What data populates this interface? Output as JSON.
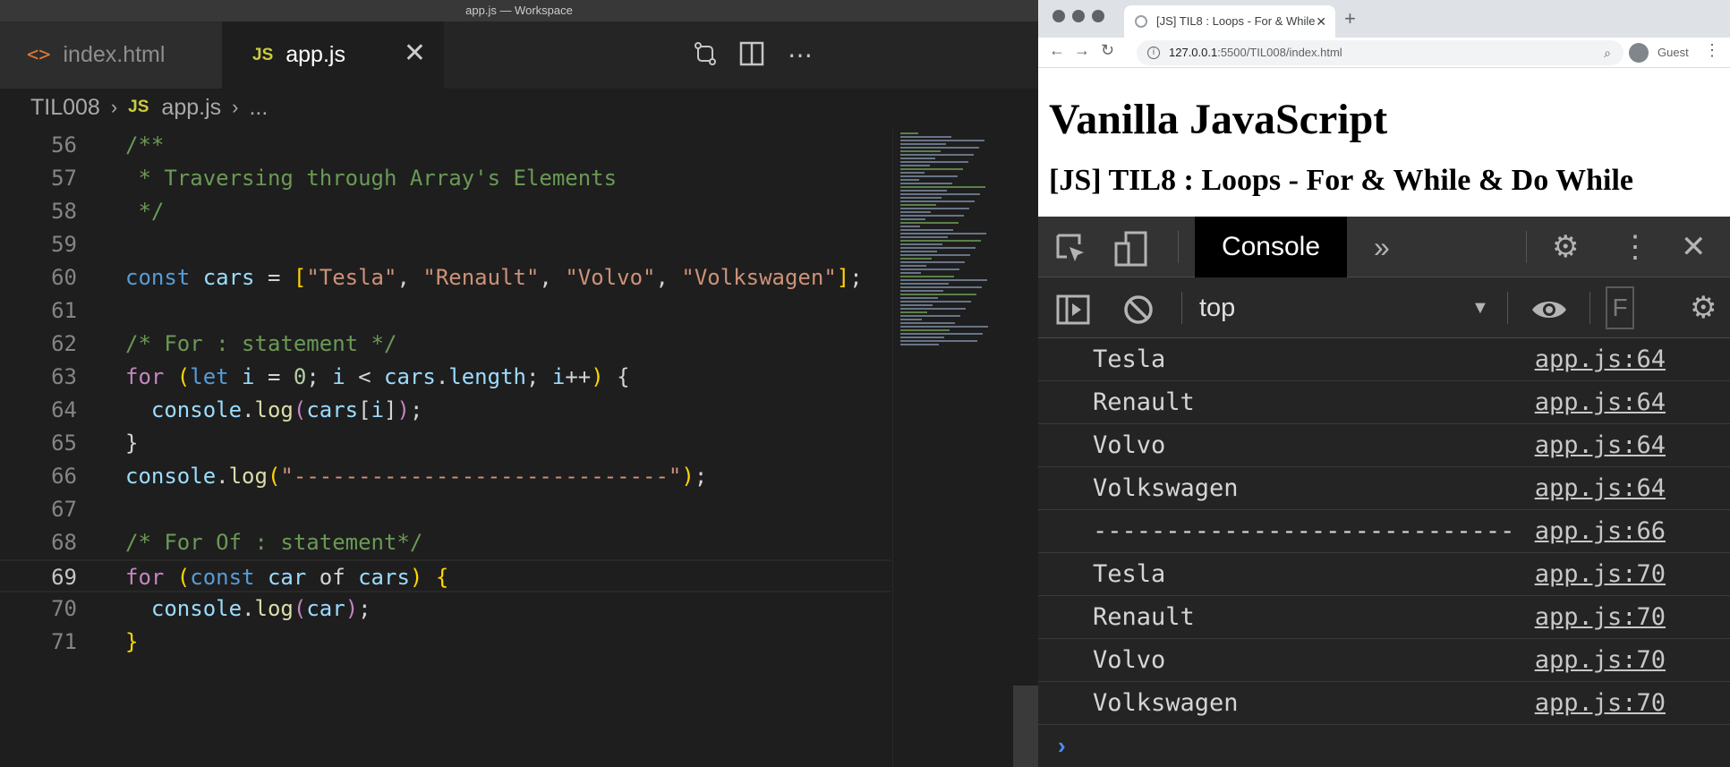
{
  "editor": {
    "window_title": "app.js — Workspace",
    "tabs": [
      {
        "label": "index.html",
        "icon": "html-icon"
      },
      {
        "label": "app.js",
        "icon": "js-icon",
        "active": true
      }
    ],
    "tab_close": "✕",
    "breadcrumb": [
      "TIL008",
      "app.js",
      "..."
    ],
    "breadcrumb_js_icon": "JS",
    "html_icon_glyph": "<>",
    "lines": [
      {
        "num": "56",
        "parts": [
          [
            "c",
            "/**"
          ]
        ]
      },
      {
        "num": "57",
        "parts": [
          [
            "c",
            " * Traversing through Array's Elements"
          ]
        ]
      },
      {
        "num": "58",
        "parts": [
          [
            "c",
            " */"
          ]
        ]
      },
      {
        "num": "59",
        "parts": []
      },
      {
        "num": "60",
        "parts": [
          [
            "k",
            "const "
          ],
          [
            "v",
            "cars"
          ],
          [
            "w",
            " = "
          ],
          [
            "y",
            "["
          ],
          [
            "s",
            "\"Tesla\""
          ],
          [
            "w",
            ", "
          ],
          [
            "s",
            "\"Renault\""
          ],
          [
            "w",
            ", "
          ],
          [
            "s",
            "\"Volvo\""
          ],
          [
            "w",
            ", "
          ],
          [
            "s",
            "\"Volkswagen\""
          ],
          [
            "y",
            "]"
          ],
          [
            "w",
            ";"
          ]
        ]
      },
      {
        "num": "61",
        "parts": []
      },
      {
        "num": "62",
        "parts": [
          [
            "c",
            "/* For : statement */"
          ]
        ]
      },
      {
        "num": "63",
        "parts": [
          [
            "p",
            "for "
          ],
          [
            "y",
            "("
          ],
          [
            "k",
            "let "
          ],
          [
            "v",
            "i"
          ],
          [
            "w",
            " = "
          ],
          [
            "n",
            "0"
          ],
          [
            "w",
            "; "
          ],
          [
            "v",
            "i"
          ],
          [
            "w",
            " < "
          ],
          [
            "v",
            "cars"
          ],
          [
            "w",
            "."
          ],
          [
            "v",
            "length"
          ],
          [
            "w",
            "; "
          ],
          [
            "v",
            "i"
          ],
          [
            "w",
            "++"
          ],
          [
            "y",
            ")"
          ],
          [
            "w",
            " {"
          ]
        ]
      },
      {
        "num": "64",
        "parts": [
          [
            "w",
            "  "
          ],
          [
            "v",
            "console"
          ],
          [
            "w",
            "."
          ],
          [
            "f",
            "log"
          ],
          [
            "p",
            "("
          ],
          [
            "v",
            "cars"
          ],
          [
            "w",
            "["
          ],
          [
            "v",
            "i"
          ],
          [
            "w",
            "]"
          ],
          [
            "p",
            ")"
          ],
          [
            "w",
            ";"
          ]
        ]
      },
      {
        "num": "65",
        "parts": [
          [
            "w",
            "}"
          ]
        ]
      },
      {
        "num": "66",
        "parts": [
          [
            "v",
            "console"
          ],
          [
            "w",
            "."
          ],
          [
            "f",
            "log"
          ],
          [
            "y",
            "("
          ],
          [
            "s",
            "\"-----------------------------\""
          ],
          [
            "y",
            ")"
          ],
          [
            "w",
            ";"
          ]
        ]
      },
      {
        "num": "67",
        "parts": []
      },
      {
        "num": "68",
        "parts": [
          [
            "c",
            "/* For Of : statement*/"
          ]
        ]
      },
      {
        "num": "69",
        "parts": [
          [
            "p",
            "for "
          ],
          [
            "y",
            "("
          ],
          [
            "k",
            "const "
          ],
          [
            "v",
            "car"
          ],
          [
            "w",
            " of "
          ],
          [
            "v",
            "cars"
          ],
          [
            "y",
            ")"
          ],
          [
            "w",
            " "
          ],
          [
            "y",
            "{"
          ]
        ],
        "active": true
      },
      {
        "num": "70",
        "parts": [
          [
            "w",
            "  "
          ],
          [
            "v",
            "console"
          ],
          [
            "w",
            "."
          ],
          [
            "f",
            "log"
          ],
          [
            "p",
            "("
          ],
          [
            "v",
            "car"
          ],
          [
            "p",
            ")"
          ],
          [
            "w",
            ";"
          ]
        ]
      },
      {
        "num": "71",
        "parts": [
          [
            "y",
            "}"
          ]
        ]
      }
    ]
  },
  "browser": {
    "tab_title": "[JS] TIL8 : Loops - For & While",
    "tab_close": "✕",
    "new_tab": "+",
    "url_host": "127.0.0.1",
    "url_rest": ":5500/TIL008/index.html",
    "profile": "Guest",
    "page": {
      "h1": "Vanilla JavaScript",
      "h2": "[JS] TIL8 : Loops - For & While & Do While"
    },
    "devtools": {
      "active_tab": "Console",
      "context": "top",
      "filter_placeholder": "F",
      "logs": [
        {
          "msg": "Tesla",
          "src": "app.js:64"
        },
        {
          "msg": "Renault",
          "src": "app.js:64"
        },
        {
          "msg": "Volvo",
          "src": "app.js:64"
        },
        {
          "msg": "Volkswagen",
          "src": "app.js:64"
        },
        {
          "msg": "-----------------------------",
          "src": "app.js:66"
        },
        {
          "msg": "Tesla",
          "src": "app.js:70"
        },
        {
          "msg": "Renault",
          "src": "app.js:70"
        },
        {
          "msg": "Volvo",
          "src": "app.js:70"
        },
        {
          "msg": "Volkswagen",
          "src": "app.js:70"
        }
      ],
      "prompt": "›"
    }
  },
  "colors": {
    "editor_bg": "#1e1e1e",
    "comment": "#6a9955",
    "keyword": "#569cd6",
    "string": "#ce9178",
    "devtools_bg": "#242424",
    "console_prompt": "#4c8df6"
  }
}
